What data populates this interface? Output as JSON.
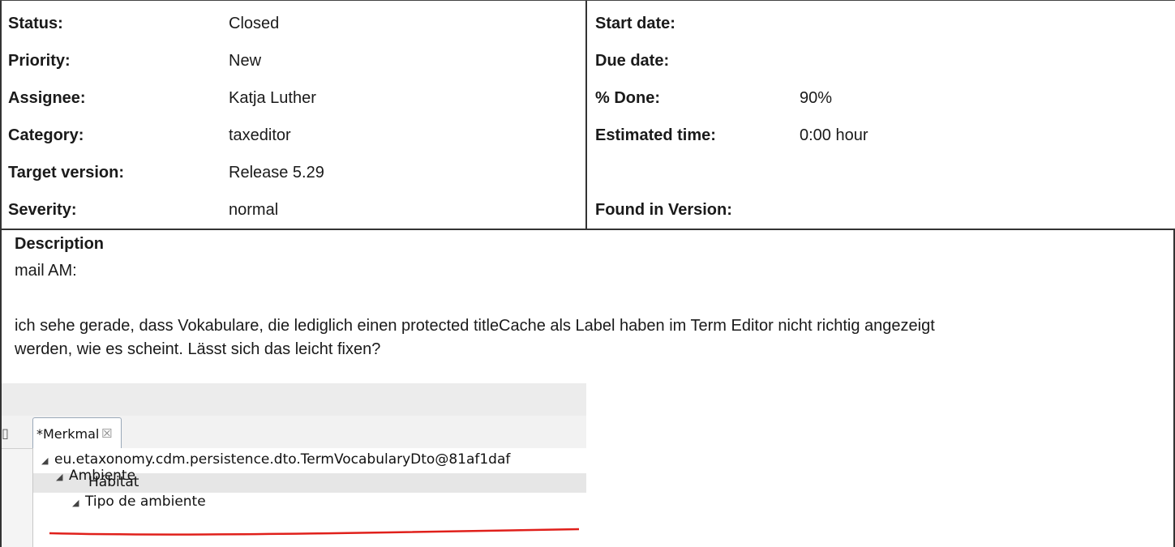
{
  "attributes": {
    "left": [
      {
        "label": "Status:",
        "value": "Closed"
      },
      {
        "label": "Priority:",
        "value": "New"
      },
      {
        "label": "Assignee:",
        "value": "Katja Luther"
      },
      {
        "label": "Category:",
        "value": "taxeditor"
      },
      {
        "label": "Target version:",
        "value": "Release 5.29"
      },
      {
        "label": "Severity:",
        "value": "normal"
      }
    ],
    "right": [
      {
        "label": "Start date:",
        "value": ""
      },
      {
        "label": "Due date:",
        "value": ""
      },
      {
        "label": "% Done:",
        "value": "90%"
      },
      {
        "label": "Estimated time:",
        "value": "0:00 hour"
      },
      {
        "label": "",
        "value": ""
      },
      {
        "label": "Found in Version:",
        "value": ""
      }
    ]
  },
  "description": {
    "heading": "Description",
    "paragraph1": "mail AM:",
    "paragraph2_line1": "ich sehe gerade, dass Vokabulare, die lediglich einen protected titleCache als Label haben im Term Editor nicht richtig angezeigt",
    "paragraph2_line2": "werden, wie es scheint. Lässt sich das leicht fixen?"
  },
  "embedded_screenshot": {
    "tab_label": "*Merkmal",
    "tab_close_glyph": "☒",
    "left_icon_glyph": "▯",
    "tree": [
      {
        "label": "eu.etaxonomy.cdm.persistence.dto.TermVocabularyDto@81af1daf",
        "expanded": true,
        "level": 0
      },
      {
        "label": "Ambiente",
        "expanded": true,
        "level": 1
      },
      {
        "label": "Hábitat",
        "expanded": false,
        "level": 2,
        "selected": true
      },
      {
        "label": "Tipo de ambiente",
        "expanded": true,
        "level": 2
      }
    ],
    "tree_expanded_glyph": "◢",
    "annotation_color": "#e0201b"
  }
}
